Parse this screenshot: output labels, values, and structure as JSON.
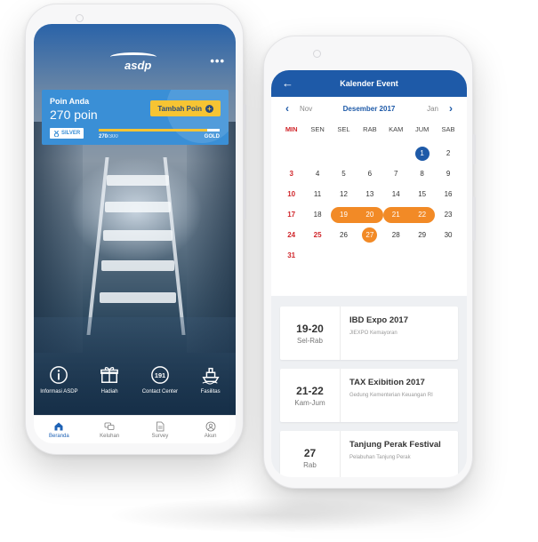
{
  "app": {
    "logo_text": "asdp",
    "more_icon": "more-horizontal-icon",
    "points": {
      "label": "Poin Anda",
      "value_text": "270 poin",
      "add_button": "Tambah Poin",
      "tier": "SILVER",
      "current": "270",
      "max": "/300",
      "next_tier": "GOLD",
      "progress_fraction": 0.9
    },
    "quick_menu": [
      {
        "label": "Informasi ASDP",
        "icon": "info-icon"
      },
      {
        "label": "Hadiah",
        "icon": "gift-icon"
      },
      {
        "label": "Contact Center",
        "icon": "contact-191-icon",
        "icon_text": "191"
      },
      {
        "label": "Fasilitas",
        "icon": "ship-icon"
      }
    ],
    "bottom_nav": [
      {
        "label": "Beranda",
        "icon": "home-icon",
        "active": true
      },
      {
        "label": "Keluhan",
        "icon": "chat-icon",
        "active": false
      },
      {
        "label": "Survey",
        "icon": "document-icon",
        "active": false
      },
      {
        "label": "Akun",
        "icon": "user-icon",
        "active": false
      }
    ]
  },
  "calendar": {
    "title": "Kalender Event",
    "back_icon": "arrow-left-icon",
    "prev_month": "Nov",
    "current_month": "Desember 2017",
    "next_month": "Jan",
    "weekdays": [
      "MIN",
      "SEN",
      "SEL",
      "RAB",
      "KAM",
      "JUM",
      "SAB"
    ],
    "weeks": [
      [
        "",
        "",
        "",
        "",
        "",
        "1",
        "2"
      ],
      [
        "3",
        "4",
        "5",
        "6",
        "7",
        "8",
        "9"
      ],
      [
        "10",
        "11",
        "12",
        "13",
        "14",
        "15",
        "16"
      ],
      [
        "17",
        "18",
        "19",
        "20",
        "21",
        "22",
        "23"
      ],
      [
        "24",
        "25",
        "26",
        "27",
        "28",
        "29",
        "30"
      ],
      [
        "31",
        "",
        "",
        "",
        "",
        "",
        ""
      ]
    ],
    "today": "1",
    "holidays": [
      "25"
    ],
    "event_ranges": [
      [
        "19",
        "20"
      ],
      [
        "21",
        "22"
      ],
      [
        "27",
        "27"
      ]
    ],
    "colors": {
      "primary": "#1e5aa8",
      "event": "#f28a26",
      "sunday": "#d0262b"
    }
  },
  "events": [
    {
      "date": "19-20",
      "days": "Sel-Rab",
      "title": "IBD Expo 2017",
      "location": "JIEXPO Kemayoran"
    },
    {
      "date": "21-22",
      "days": "Kam-Jum",
      "title": "TAX Exibition 2017",
      "location": "Gedung Kementerian Keuangan RI"
    },
    {
      "date": "27",
      "days": "Rab",
      "title": "Tanjung Perak Festival",
      "location": "Pelabuhan Tanjung Perak"
    }
  ]
}
